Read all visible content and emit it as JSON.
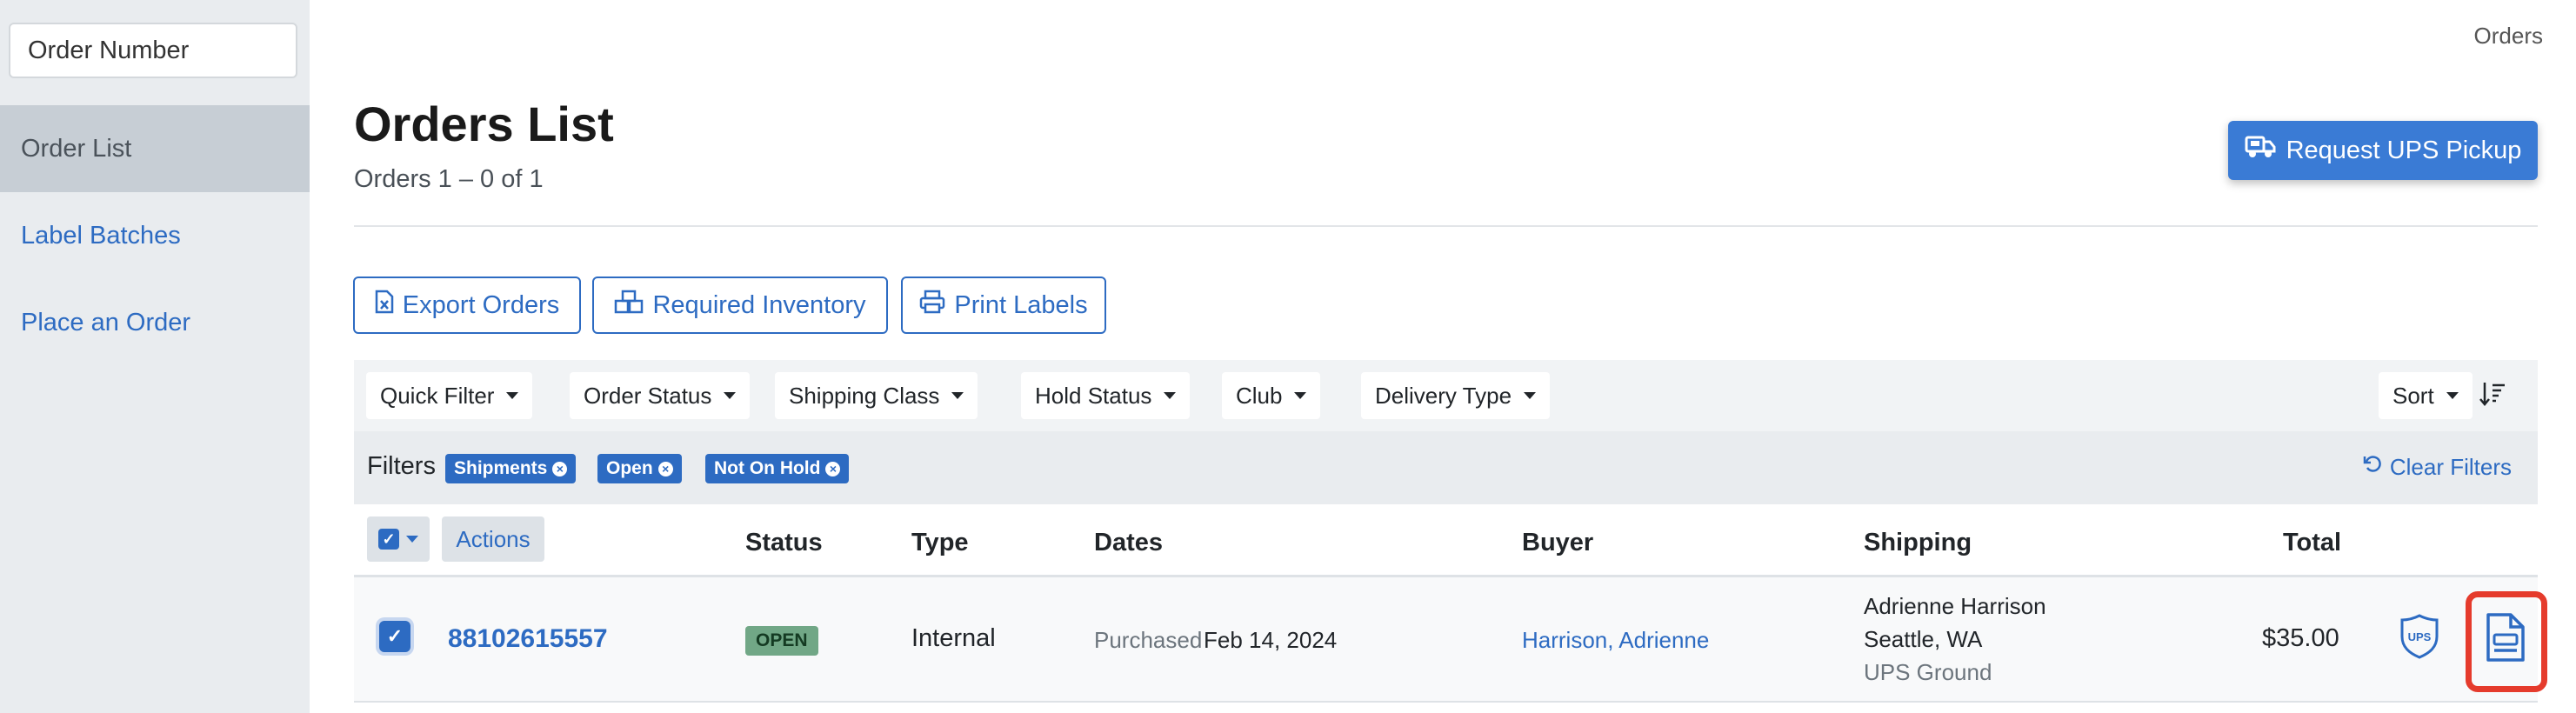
{
  "sidebar": {
    "search_placeholder": "Order Number",
    "items": [
      {
        "label": "Order List",
        "active": true
      },
      {
        "label": "Label Batches",
        "active": false
      },
      {
        "label": "Place an Order",
        "active": false
      }
    ]
  },
  "header": {
    "breadcrumb": "Orders",
    "title": "Orders List",
    "subtitle": "Orders 1 – 0 of 1",
    "ups_button": "Request UPS Pickup"
  },
  "toolbar": {
    "export_label": "Export Orders",
    "inventory_label": "Required Inventory",
    "print_label": "Print Labels"
  },
  "filter_bar": {
    "dropdowns": [
      "Quick Filter",
      "Order Status",
      "Shipping Class",
      "Hold Status",
      "Club",
      "Delivery Type"
    ],
    "sort_label": "Sort"
  },
  "active_filters": {
    "label": "Filters",
    "chips": [
      "Shipments",
      "Open",
      "Not On Hold"
    ],
    "clear_label": "Clear Filters"
  },
  "table": {
    "actions_label": "Actions",
    "columns": [
      "Status",
      "Type",
      "Dates",
      "Buyer",
      "Shipping",
      "Total"
    ],
    "rows": [
      {
        "order_number": "88102615557",
        "status": "OPEN",
        "type": "Internal",
        "date_prefix": "Purchased",
        "date": "Feb 14, 2024",
        "buyer": "Harrison, Adrienne",
        "ship_name": "Adrienne Harrison",
        "ship_city": "Seattle, WA",
        "ship_method": "UPS Ground",
        "total": "$35.00",
        "carrier": "UPS"
      }
    ]
  },
  "colors": {
    "accent": "#2d6bc2",
    "highlight": "#e53b2c",
    "status_open": "#71a786"
  }
}
